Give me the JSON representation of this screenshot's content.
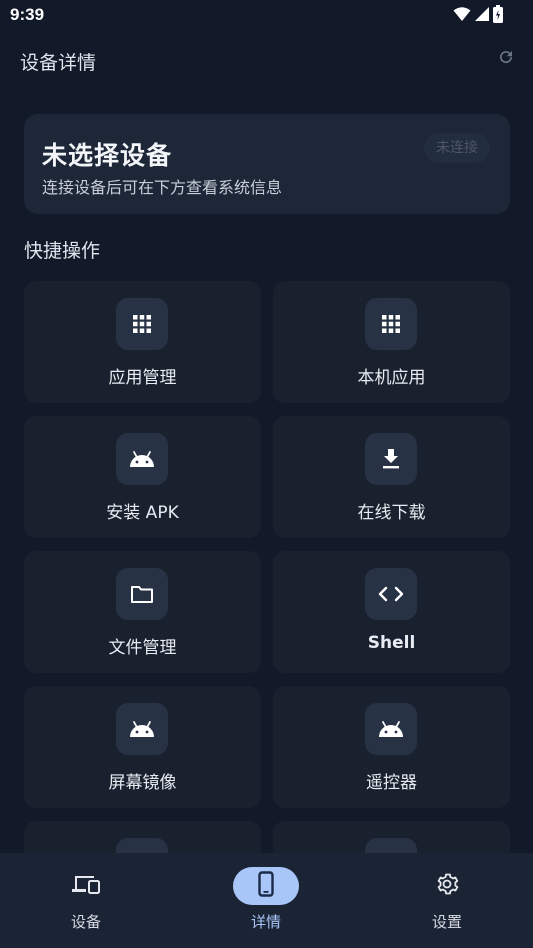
{
  "status_bar": {
    "time": "9:39"
  },
  "app_bar": {
    "title": "设备详情",
    "refresh_icon": "refresh-icon"
  },
  "device_card": {
    "title": "未选择设备",
    "subtitle": "连接设备后可在下方查看系统信息",
    "badge": "未连接"
  },
  "quick_actions": {
    "title": "快捷操作",
    "items": [
      {
        "label": "应用管理",
        "icon": "apps-grid-icon"
      },
      {
        "label": "本机应用",
        "icon": "apps-grid-icon"
      },
      {
        "label": "安装 APK",
        "icon": "android-icon"
      },
      {
        "label": "在线下载",
        "icon": "download-icon"
      },
      {
        "label": "文件管理",
        "icon": "folder-icon"
      },
      {
        "label": "Shell",
        "icon": "code-icon"
      },
      {
        "label": "屏幕镜像",
        "icon": "android-icon"
      },
      {
        "label": "遥控器",
        "icon": "android-icon"
      }
    ]
  },
  "bottom_nav": {
    "items": [
      {
        "label": "设备",
        "icon": "devices-icon"
      },
      {
        "label": "详情",
        "icon": "phone-icon",
        "active": true
      },
      {
        "label": "设置",
        "icon": "gear-icon"
      }
    ]
  },
  "colors": {
    "background": "#121a29",
    "card": "#1d2738",
    "tile": "#19212f",
    "accent": "#a9c6f8"
  }
}
